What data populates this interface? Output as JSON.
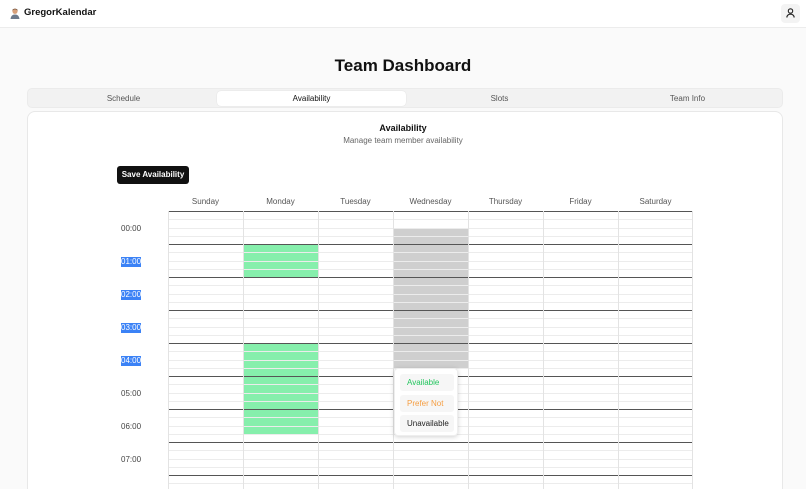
{
  "app": {
    "name": "GregorKalendar"
  },
  "page": {
    "title": "Team Dashboard"
  },
  "tabs": [
    {
      "label": "Schedule"
    },
    {
      "label": "Availability",
      "active": true
    },
    {
      "label": "Slots"
    },
    {
      "label": "Team Info"
    }
  ],
  "card": {
    "title": "Availability",
    "subtitle": "Manage team member availability"
  },
  "save_button": {
    "label": "Save Availability"
  },
  "days": [
    "Sunday",
    "Monday",
    "Tuesday",
    "Wednesday",
    "Thursday",
    "Friday",
    "Saturday"
  ],
  "hours": [
    {
      "label": "00:00",
      "selected": false
    },
    {
      "label": "01:00",
      "selected": true
    },
    {
      "label": "02:00",
      "selected": true
    },
    {
      "label": "03:00",
      "selected": true
    },
    {
      "label": "04:00",
      "selected": true
    },
    {
      "label": "05:00",
      "selected": false
    },
    {
      "label": "06:00",
      "selected": false
    },
    {
      "label": "07:00",
      "selected": false
    }
  ],
  "slots_per_hour": 4,
  "availability": [
    {
      "day": "Monday",
      "from": "01:00",
      "to": "02:00",
      "status": "available"
    },
    {
      "day": "Monday",
      "from": "04:00",
      "to": "06:45",
      "status": "available"
    },
    {
      "day": "Wednesday",
      "from": "00:30",
      "to": "04:45",
      "status": "unavailable"
    }
  ],
  "status_menu": {
    "items": [
      {
        "label": "Available",
        "color": "#22c55e"
      },
      {
        "label": "Prefer Not",
        "color": "#f59e42"
      },
      {
        "label": "Unavailable",
        "color": "#222222"
      }
    ]
  },
  "colors": {
    "available": "#86efac",
    "unavailable": "#cfcfcf",
    "selection": "#3b82f6"
  }
}
